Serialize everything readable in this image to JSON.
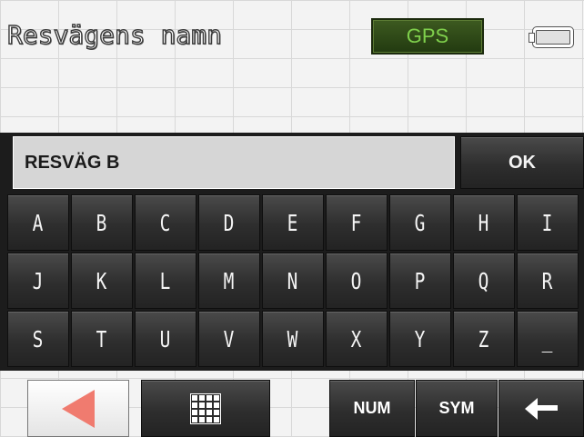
{
  "header": {
    "title": "Resvägens namn",
    "gps_label": "GPS",
    "battery_icon": "battery-icon"
  },
  "input": {
    "value": "RESVÄG B"
  },
  "ok_label": "OK",
  "keyboard": {
    "rows": [
      [
        "A",
        "B",
        "C",
        "D",
        "E",
        "F",
        "G",
        "H",
        "I"
      ],
      [
        "J",
        "K",
        "L",
        "M",
        "N",
        "O",
        "P",
        "Q",
        "R"
      ],
      [
        "S",
        "T",
        "U",
        "V",
        "W",
        "X",
        "Y",
        "Z",
        "_"
      ]
    ]
  },
  "bottom_bar": {
    "back_icon": "back-arrow-icon",
    "grid_icon": "keypad-grid-icon",
    "num_label": "NUM",
    "sym_label": "SYM",
    "backspace_icon": "backspace-icon"
  },
  "colors": {
    "gps_text": "#7fd04c",
    "back_arrow": "#f07b6f",
    "panel": "#1c1c1c"
  }
}
